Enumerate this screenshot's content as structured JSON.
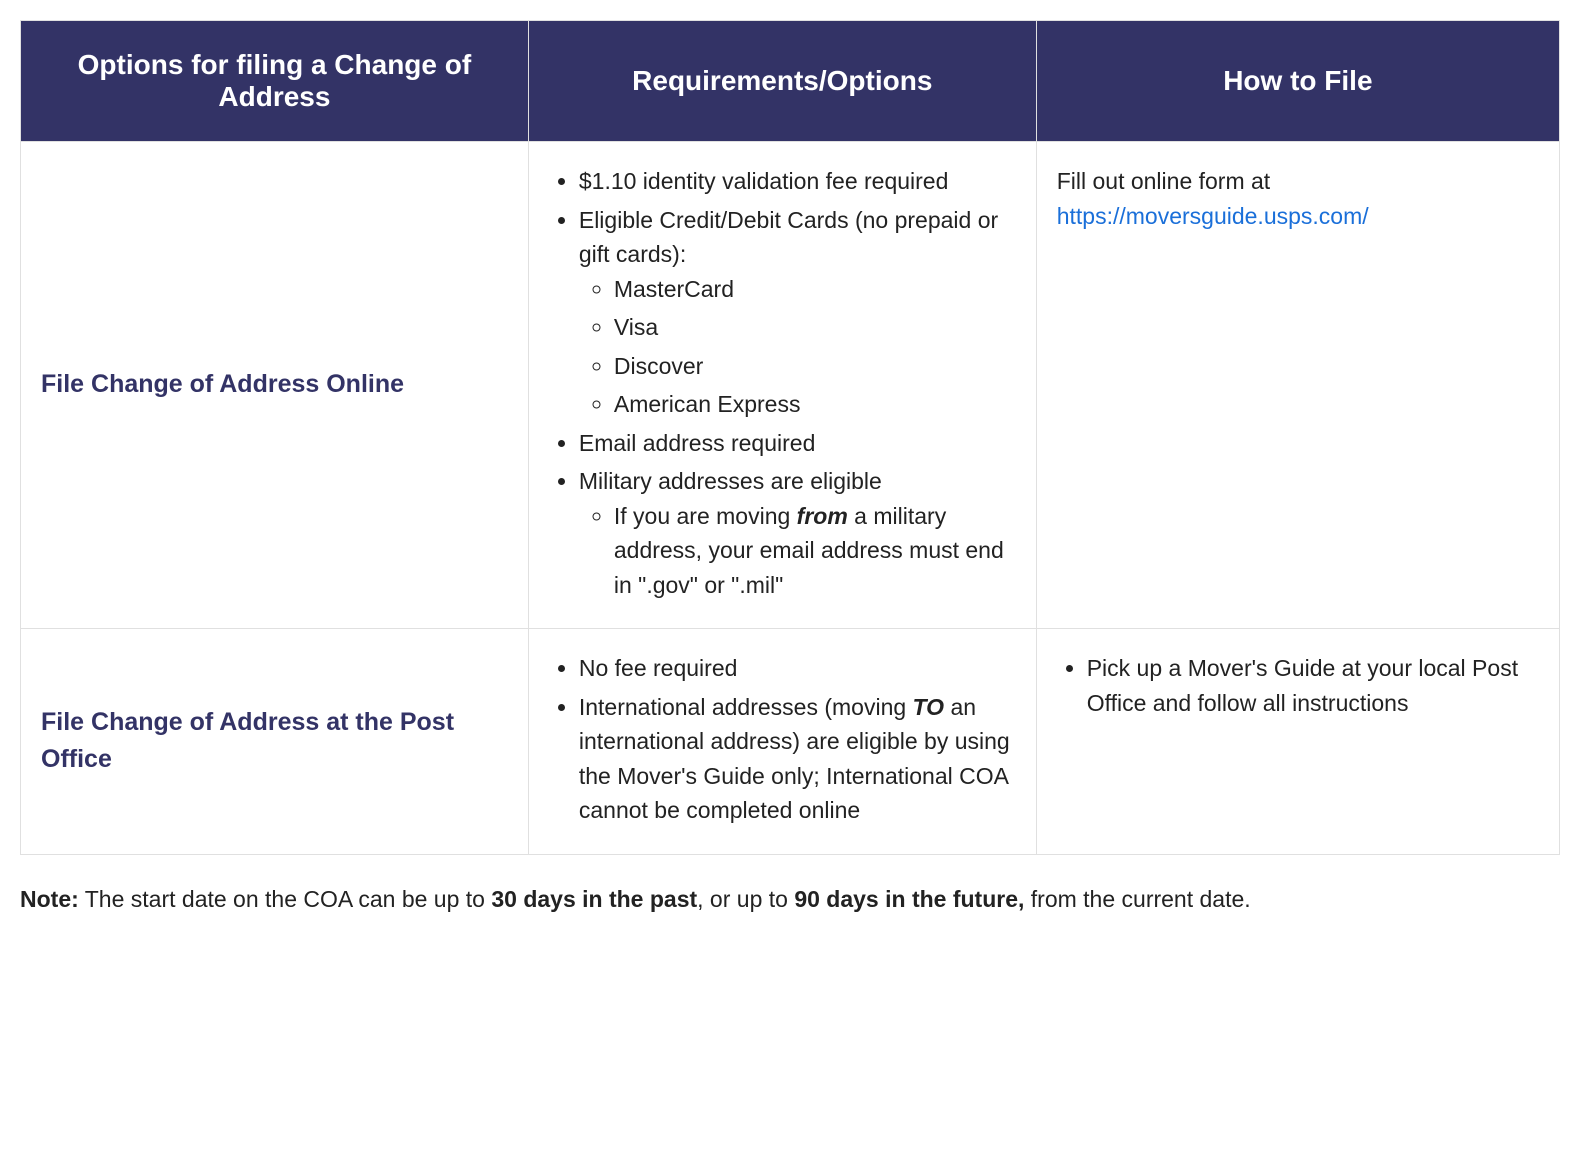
{
  "headers": {
    "col1": "Options for filing a Change of Address",
    "col2": "Requirements/Options",
    "col3": "How to File"
  },
  "rows": {
    "online": {
      "option": "File Change of Address Online",
      "req": {
        "item1": "$1.10 identity validation fee required",
        "item2": "Eligible Credit/Debit Cards (no prepaid or gift cards):",
        "cards": {
          "c1": "MasterCard",
          "c2": "Visa",
          "c3": "Discover",
          "c4": "American Express"
        },
        "item3": "Email address required",
        "item4": "Military addresses are eligible",
        "mil": {
          "prefix": "If you are moving ",
          "em": "from",
          "suffix": " a military address, your email address must end in \".gov\" or \".mil\""
        }
      },
      "how": {
        "text_prefix": "Fill out online form at ",
        "link_text": "https://moversguide.usps.com/"
      }
    },
    "postoffice": {
      "option": "File Change of Address at the Post Office",
      "req": {
        "item1": "No fee required",
        "item2_prefix": "International addresses (moving ",
        "item2_em": "TO",
        "item2_suffix": " an international address) are eligible by using the Mover's Guide only; International COA cannot be completed online"
      },
      "how": {
        "item1": "Pick up a Mover's Guide at your local Post Office and follow all instructions"
      }
    }
  },
  "note": {
    "label": "Note:",
    "part1": " The start date on the COA can be up to ",
    "bold1": "30 days in the past",
    "part2": ", or up to ",
    "bold2": "90 days in the future,",
    "part3": " from the current date."
  }
}
